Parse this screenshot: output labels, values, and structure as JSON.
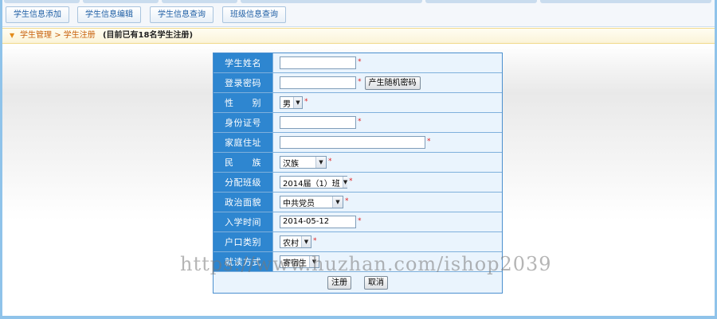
{
  "top_tabs": [
    {
      "label": "学生信息添加"
    },
    {
      "label": "学生信息编辑"
    },
    {
      "label": "学生信息查询"
    },
    {
      "label": "班级信息查询"
    }
  ],
  "breadcrumb": {
    "part1": "学生管理",
    "separator": ">",
    "part2": "学生注册",
    "note": "(目前已有18名学生注册)"
  },
  "form": {
    "name": {
      "label": "学生姓名",
      "value": ""
    },
    "password": {
      "label": "登录密码",
      "value": "",
      "gen_button": "产生随机密码"
    },
    "gender": {
      "label": "性　　别",
      "value": "男"
    },
    "id_card": {
      "label": "身份证号",
      "value": ""
    },
    "address": {
      "label": "家庭住址",
      "value": ""
    },
    "ethnicity": {
      "label": "民　　族",
      "value": "汉族"
    },
    "class": {
      "label": "分配班级",
      "value": "2014届（1）班"
    },
    "political": {
      "label": "政治面貌",
      "value": "中共党员"
    },
    "enroll": {
      "label": "入学时间",
      "value": "2014-05-12"
    },
    "hukou": {
      "label": "户口类别",
      "value": "农村"
    },
    "study": {
      "label": "就读方式",
      "value": "寄宿生"
    },
    "required_mark": "*",
    "submit_label": "注册",
    "cancel_label": "取消"
  },
  "watermark": "https://www.huzhan.com/ishop2039",
  "colors": {
    "label_bg": "#2e86d0",
    "field_bg": "#eaf4fd",
    "frame": "#8fc3ea",
    "required": "#e02020"
  }
}
